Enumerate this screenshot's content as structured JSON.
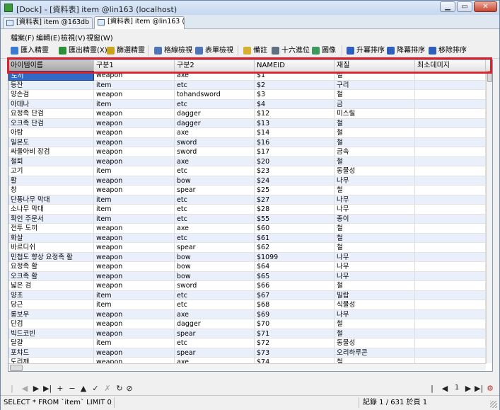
{
  "window": {
    "title": "[Dock] - [資料表] item @lin163 (localhost)"
  },
  "tabs": [
    {
      "label": "[資料表] item @163db (l...",
      "active": false
    },
    {
      "label": "[資料表] item @lin163 (lo...",
      "active": true
    }
  ],
  "menu": [
    {
      "label": "檔案(F)"
    },
    {
      "label": "編輯(E)"
    },
    {
      "label": "檢視(V)"
    },
    {
      "label": "視窗(W)"
    }
  ],
  "toolbar": [
    {
      "label": "匯入精靈",
      "icon": "import-wizard-icon",
      "color": "#3a7bd5",
      "disabled": false
    },
    {
      "label": "匯出精靈(X)",
      "icon": "export-wizard-icon",
      "color": "#2d8f3a",
      "disabled": false
    },
    {
      "label": "篩選精靈",
      "icon": "filter-wizard-icon",
      "color": "#c9a21e",
      "disabled": false
    },
    {
      "label": "格線檢視",
      "icon": "grid-view-icon",
      "color": "#4f74b8",
      "disabled": false
    },
    {
      "label": "表單檢視",
      "icon": "form-view-icon",
      "color": "#4f74b8",
      "disabled": false
    },
    {
      "label": "備註",
      "icon": "memo-icon",
      "color": "#d8b030",
      "disabled": false
    },
    {
      "label": "十六進位",
      "icon": "hex-icon",
      "color": "#607080",
      "disabled": false
    },
    {
      "label": "圖像",
      "icon": "image-icon",
      "color": "#3d9a5a",
      "disabled": false
    },
    {
      "label": "升冪排序",
      "icon": "sort-ascending-icon",
      "color": "#2e5fbf",
      "disabled": false
    },
    {
      "label": "降冪排序",
      "icon": "sort-descending-icon",
      "color": "#2e5fbf",
      "disabled": false
    },
    {
      "label": "移除排序",
      "icon": "remove-sort-icon",
      "color": "#2e5fbf",
      "disabled": false
    }
  ],
  "grid": {
    "columns": [
      "아이템이름",
      "구분1",
      "구분2",
      "NAMEID",
      "재질",
      "최소데미지"
    ],
    "rows": [
      [
        "도끼",
        "weapon",
        "axe",
        "$1",
        "철",
        ""
      ],
      [
        "등잔",
        "item",
        "etc",
        "$2",
        "구리",
        ""
      ],
      [
        "양손검",
        "weapon",
        "tohandsword",
        "$3",
        "철",
        ""
      ],
      [
        "아데나",
        "item",
        "etc",
        "$4",
        "금",
        ""
      ],
      [
        "요정족 단검",
        "weapon",
        "dagger",
        "$12",
        "미스릴",
        ""
      ],
      [
        "오크족 단검",
        "weapon",
        "dagger",
        "$13",
        "철",
        ""
      ],
      [
        "아탐",
        "weapon",
        "axe",
        "$14",
        "철",
        ""
      ],
      [
        "일본도",
        "weapon",
        "sword",
        "$16",
        "철",
        ""
      ],
      [
        "싸울아비 장검",
        "weapon",
        "sword",
        "$17",
        "금속",
        ""
      ],
      [
        "철퇴",
        "weapon",
        "axe",
        "$20",
        "철",
        ""
      ],
      [
        "고기",
        "item",
        "etc",
        "$23",
        "동물성",
        ""
      ],
      [
        "활",
        "weapon",
        "bow",
        "$24",
        "나무",
        ""
      ],
      [
        "창",
        "weapon",
        "spear",
        "$25",
        "철",
        ""
      ],
      [
        "단풍나무 막대",
        "item",
        "etc",
        "$27",
        "나무",
        ""
      ],
      [
        "소나무 막대",
        "item",
        "etc",
        "$28",
        "나무",
        ""
      ],
      [
        "확인 주문서",
        "item",
        "etc",
        "$55",
        "종이",
        ""
      ],
      [
        "전투 도끼",
        "weapon",
        "axe",
        "$60",
        "철",
        ""
      ],
      [
        "화살",
        "weapon",
        "etc",
        "$61",
        "철",
        ""
      ],
      [
        "바르디쉬",
        "weapon",
        "spear",
        "$62",
        "철",
        ""
      ],
      [
        "민첩도 향상 요정족 활",
        "weapon",
        "bow",
        "$1099",
        "나무",
        ""
      ],
      [
        "요정족 활",
        "weapon",
        "bow",
        "$64",
        "나무",
        ""
      ],
      [
        "오크족 활",
        "weapon",
        "bow",
        "$65",
        "나무",
        ""
      ],
      [
        "넓은 검",
        "weapon",
        "sword",
        "$66",
        "철",
        ""
      ],
      [
        "양초",
        "item",
        "etc",
        "$67",
        "밀랍",
        ""
      ],
      [
        "당근",
        "item",
        "etc",
        "$68",
        "식물성",
        ""
      ],
      [
        "롱보우",
        "weapon",
        "axe",
        "$69",
        "나무",
        ""
      ],
      [
        "단검",
        "weapon",
        "dagger",
        "$70",
        "철",
        ""
      ],
      [
        "빅드코빈",
        "weapon",
        "spear",
        "$71",
        "철",
        ""
      ],
      [
        "달걀",
        "item",
        "etc",
        "$72",
        "동물성",
        ""
      ],
      [
        "포챠드",
        "weapon",
        "spear",
        "$73",
        "오리하루콘",
        ""
      ],
      [
        "도리깨",
        "weapon",
        "axe",
        "$74",
        "철",
        ""
      ]
    ]
  },
  "status": {
    "sql": "SELECT * FROM `item` LIMIT 0,1000",
    "records": "記錄 1 / 631 於頁 1",
    "page": "1"
  }
}
